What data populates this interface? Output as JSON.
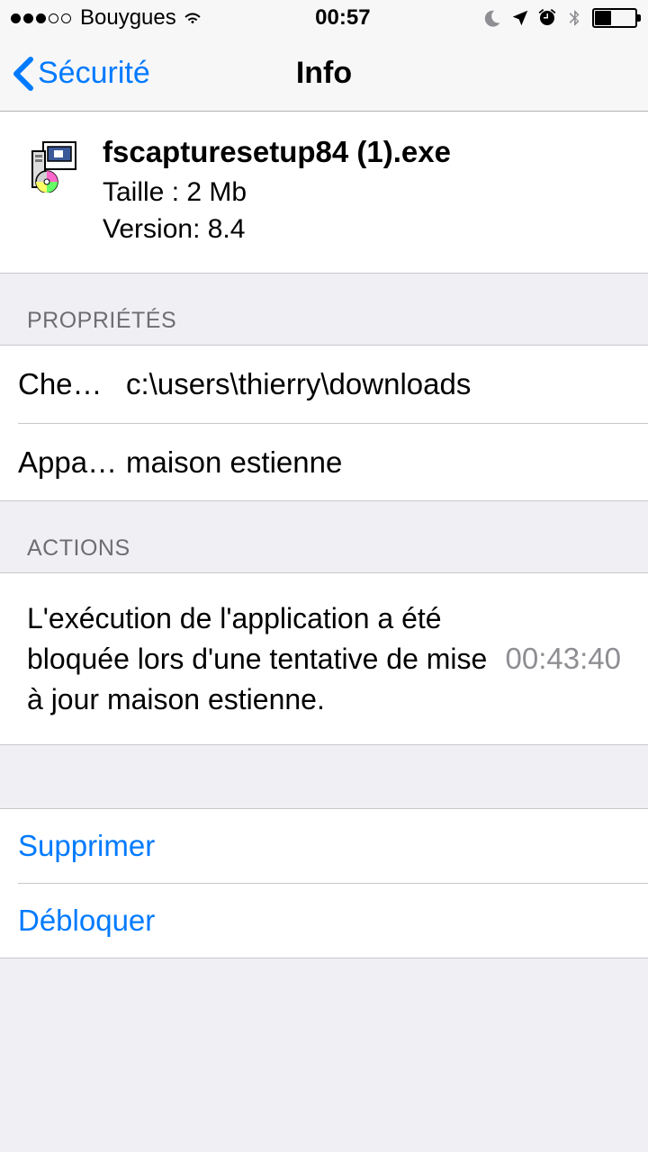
{
  "statusbar": {
    "carrier": "Bouygues",
    "time": "00:57"
  },
  "nav": {
    "back_label": "Sécurité",
    "title": "Info"
  },
  "file": {
    "name": "fscapturesetup84 (1).exe",
    "size_line": "Taille : 2 Mb",
    "version_line": "Version: 8.4"
  },
  "sections": {
    "properties_header": "PROPRIÉTÉS",
    "path_key": "Chemin...",
    "path_value": "c:\\users\\thierry\\downloads",
    "device_key": "Appareil",
    "device_value": "maison estienne",
    "actions_header": "ACTIONS",
    "action_description": "L'exécution de l'application a été bloquée lors d'une tentative de mise à jour maison estienne.",
    "action_time": "00:43:40"
  },
  "buttons": {
    "delete": "Supprimer",
    "unblock": "Débloquer"
  }
}
